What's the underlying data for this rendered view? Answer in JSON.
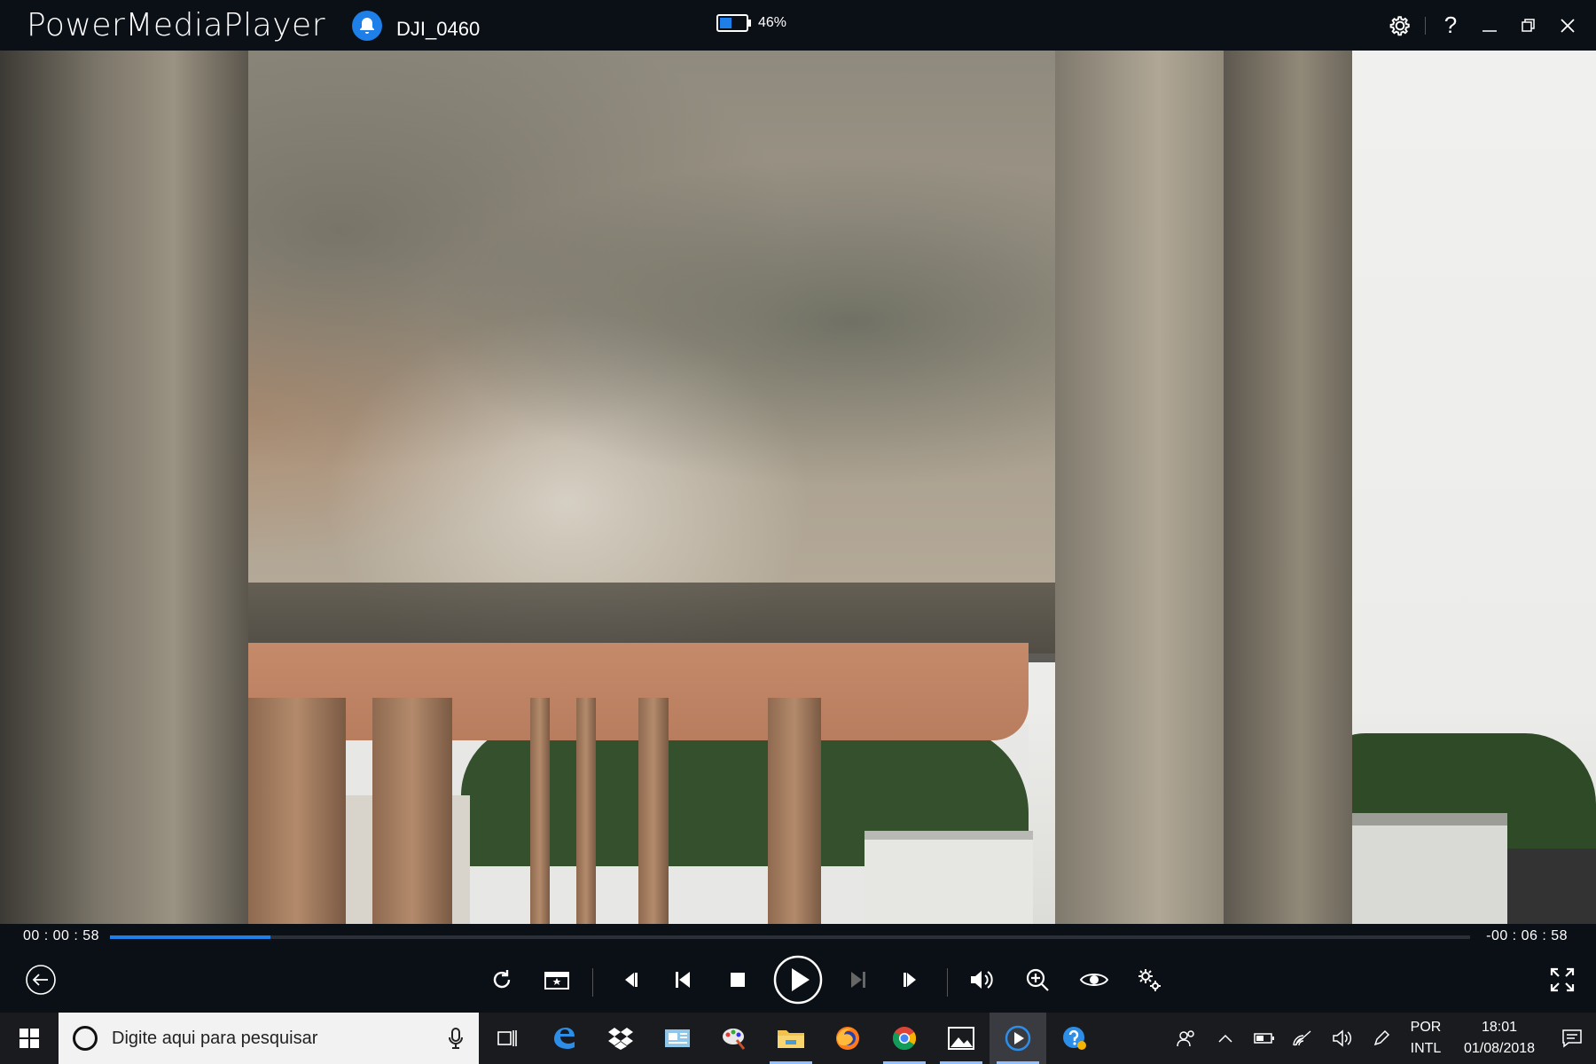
{
  "app": {
    "title": "PowerMediaPlayer",
    "file_name": "DJI_0460"
  },
  "battery": {
    "percent_label": "46%",
    "level": 0.46,
    "color": "#1e7fe8"
  },
  "title_actions": [
    "settings-icon",
    "help-icon",
    "minimize-icon",
    "restore-icon",
    "close-icon"
  ],
  "help_glyph": "?",
  "player": {
    "current_time": "00 : 00 : 58",
    "remaining_time": "-00 : 06 : 58",
    "progress_fraction": 0.118,
    "accent": "#1e7fe8"
  },
  "controls": [
    "back-icon",
    "rotate-icon",
    "snapshot-icon",
    "frame-back-icon",
    "previous-icon",
    "stop-icon",
    "play-icon",
    "next-icon",
    "frame-forward-icon",
    "volume-icon",
    "zoom-icon",
    "eye-icon",
    "advanced-settings-icon",
    "fullscreen-icon"
  ],
  "taskbar": {
    "search_placeholder": "Digite aqui para pesquisar",
    "apps": [
      "task-view-icon",
      "edge-icon",
      "dropbox-icon",
      "mail-icon",
      "paint-icon",
      "file-explorer-icon",
      "firefox-icon",
      "chrome-icon",
      "photos-icon",
      "powermediaplayer-icon",
      "help-app-icon"
    ],
    "tray": {
      "lang_top": "POR",
      "lang_bottom": "INTL",
      "time": "18:01",
      "date": "01/08/2018"
    }
  }
}
